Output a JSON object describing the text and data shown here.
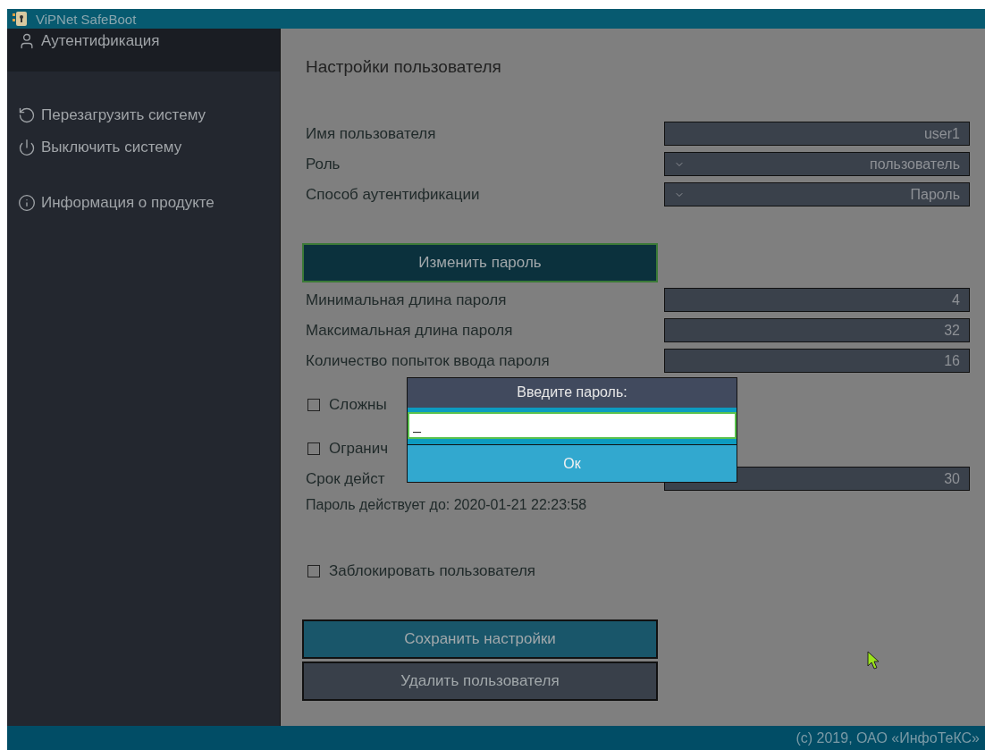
{
  "window": {
    "title": "ViPNet SafeBoot"
  },
  "sidebar": {
    "items": [
      {
        "label": "Аутентификация",
        "selected": true
      },
      {
        "label": "Перезагрузить систему",
        "selected": false
      },
      {
        "label": "Выключить систему",
        "selected": false
      },
      {
        "label": "Информация о продукте",
        "selected": false
      }
    ]
  },
  "heading": "Настройки пользователя",
  "rows": [
    {
      "kind": "field",
      "label": "Имя пользователя",
      "value": "user1"
    },
    {
      "kind": "select",
      "label": "Роль",
      "value": "пользователь"
    },
    {
      "kind": "select",
      "label": "Способ аутентификации",
      "value": "Пароль"
    },
    {
      "kind": "button",
      "label": "Изменить пароль",
      "focused": true
    },
    {
      "kind": "field",
      "label": "Минимальная длина пароля",
      "value": "4"
    },
    {
      "kind": "field",
      "label": "Максимальная длина пароля",
      "value": "32"
    },
    {
      "kind": "field",
      "label": "Количество попыток ввода пароля",
      "value": "16"
    },
    {
      "kind": "checkbox",
      "label": "Сложны",
      "checked": false
    },
    {
      "kind": "checkbox",
      "label": "Огранич",
      "checked": false
    },
    {
      "kind": "field",
      "label": "Срок дейст",
      "value": "30"
    },
    {
      "kind": "text",
      "label": "Пароль действует до: 2020-01-21 22:23:58"
    },
    {
      "kind": "checkbox",
      "label": "Заблокировать пользователя",
      "checked": false
    }
  ],
  "actions": [
    {
      "label": "Сохранить настройки",
      "kind": "primary"
    },
    {
      "label": "Удалить пользователя",
      "kind": "secondary"
    }
  ],
  "dialog": {
    "title": "Введите пароль:",
    "value": "_",
    "button": "Ок"
  },
  "footer": "(с) 2019, ОАО «ИнфоТеКС»"
}
